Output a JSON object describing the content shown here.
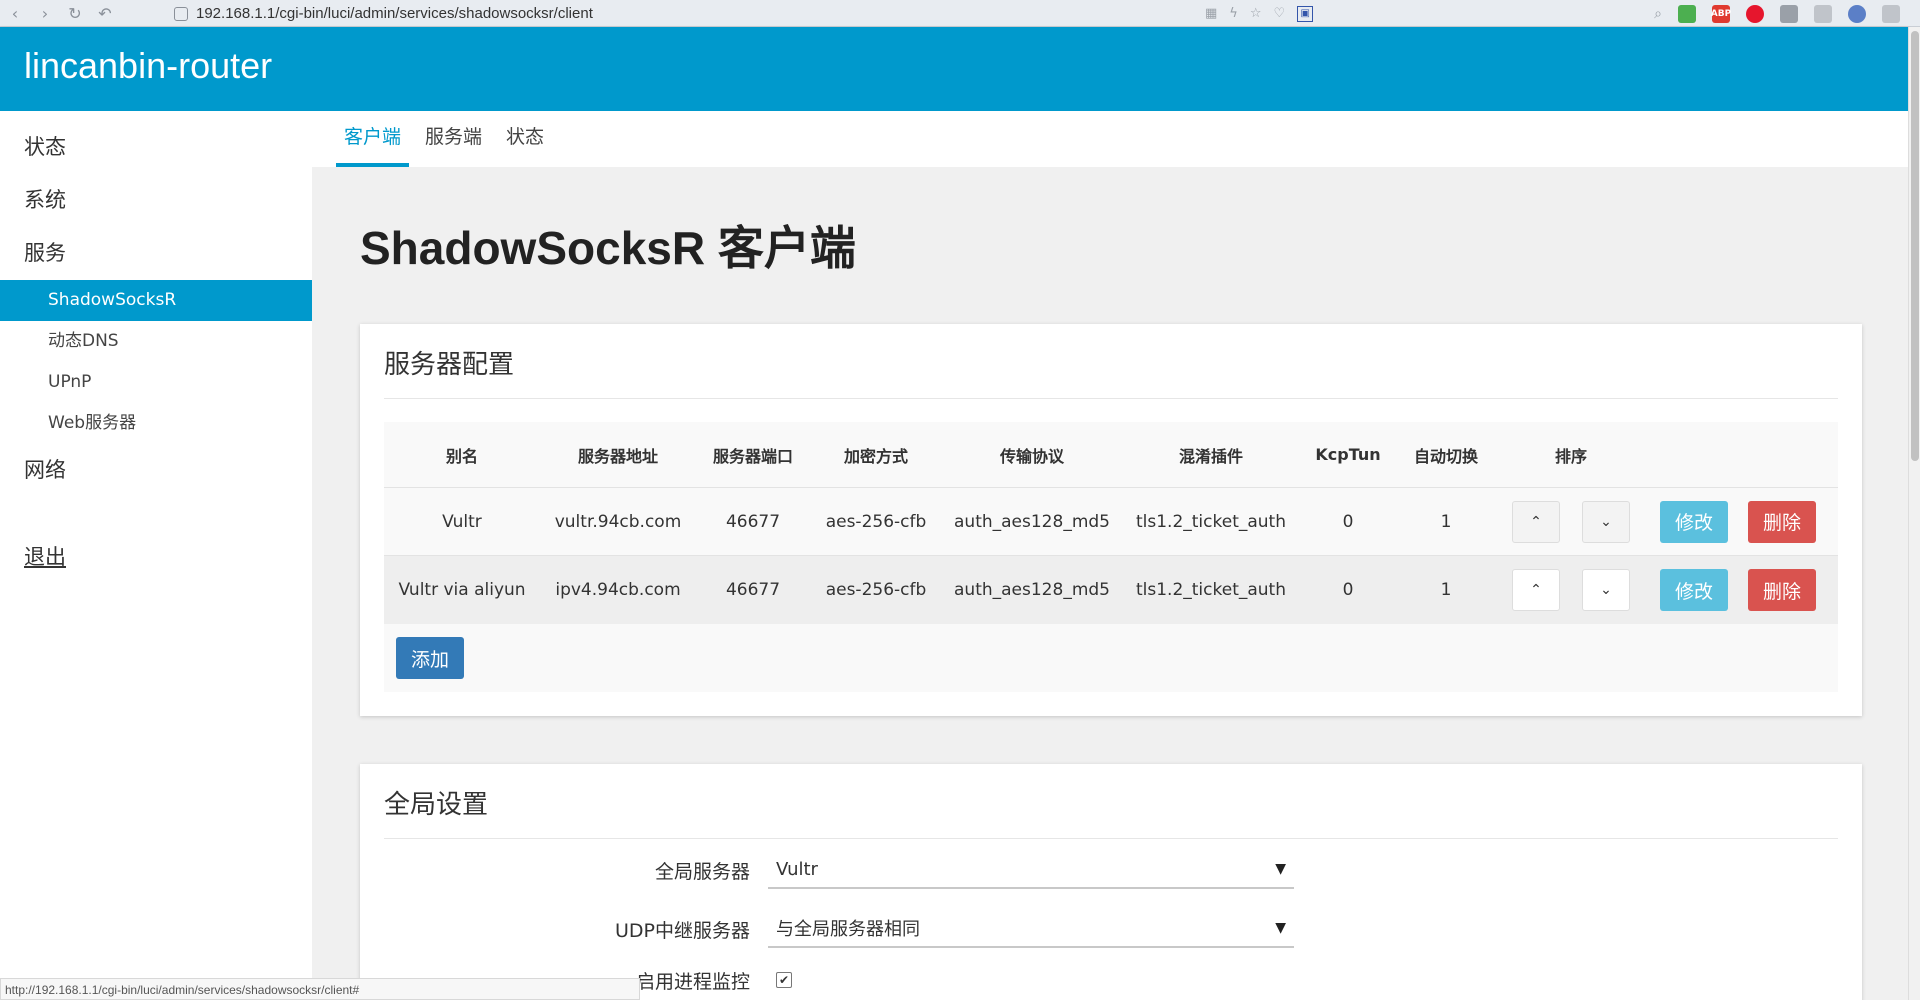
{
  "browser": {
    "url": "192.168.1.1/cgi-bin/luci/admin/services/shadowsocksr/client",
    "extensions": [
      {
        "name": "windows-icon",
        "color": "#4caf50",
        "label": ""
      },
      {
        "name": "abp-icon",
        "color": "#e03a2f",
        "label": "ABP"
      },
      {
        "name": "weibo-icon",
        "color": "#e6162d",
        "label": ""
      },
      {
        "name": "camera-icon",
        "color": "#9aa0a8",
        "label": ""
      },
      {
        "name": "shield-icon",
        "color": "#9aa0a8",
        "label": ""
      },
      {
        "name": "circle-icon",
        "color": "#5b7fc7",
        "label": ""
      },
      {
        "name": "download-icon",
        "color": "#9aa0a8",
        "label": ""
      }
    ]
  },
  "header": {
    "brand": "lincanbin-router"
  },
  "sidebar": {
    "status": "状态",
    "system": "系统",
    "services": "服务",
    "sub": {
      "ssr": "ShadowSocksR",
      "ddns": "动态DNS",
      "upnp": "UPnP",
      "web": "Web服务器"
    },
    "network": "网络",
    "logout": "退出"
  },
  "tabs": {
    "client": "客户端",
    "server": "服务端",
    "status": "状态"
  },
  "page": {
    "title": "ShadowSocksR 客户端"
  },
  "server_config": {
    "title": "服务器配置",
    "columns": [
      "别名",
      "服务器地址",
      "服务器端口",
      "加密方式",
      "传输协议",
      "混淆插件",
      "KcpTun",
      "自动切换",
      "排序"
    ],
    "rows": [
      {
        "alias": "Vultr",
        "address": "vultr.94cb.com",
        "port": "46677",
        "method": "aes-256-cfb",
        "protocol": "auth_aes128_md5",
        "obfs": "tls1.2_ticket_auth",
        "kcptun": "0",
        "autoswitch": "1"
      },
      {
        "alias": "Vultr via aliyun",
        "address": "ipv4.94cb.com",
        "port": "46677",
        "method": "aes-256-cfb",
        "protocol": "auth_aes128_md5",
        "obfs": "tls1.2_ticket_auth",
        "kcptun": "0",
        "autoswitch": "1"
      }
    ],
    "edit_label": "修改",
    "delete_label": "删除",
    "add_label": "添加",
    "up_glyph": "⌃",
    "down_glyph": "⌄"
  },
  "global": {
    "title": "全局设置",
    "global_server_label": "全局服务器",
    "global_server_value": "Vultr",
    "udp_label": "UDP中继服务器",
    "udp_value": "与全局服务器相同",
    "monitor_label": "启用进程监控",
    "monitor_checked": true
  },
  "status_url": "http://192.168.1.1/cgi-bin/luci/admin/services/shadowsocksr/client#"
}
